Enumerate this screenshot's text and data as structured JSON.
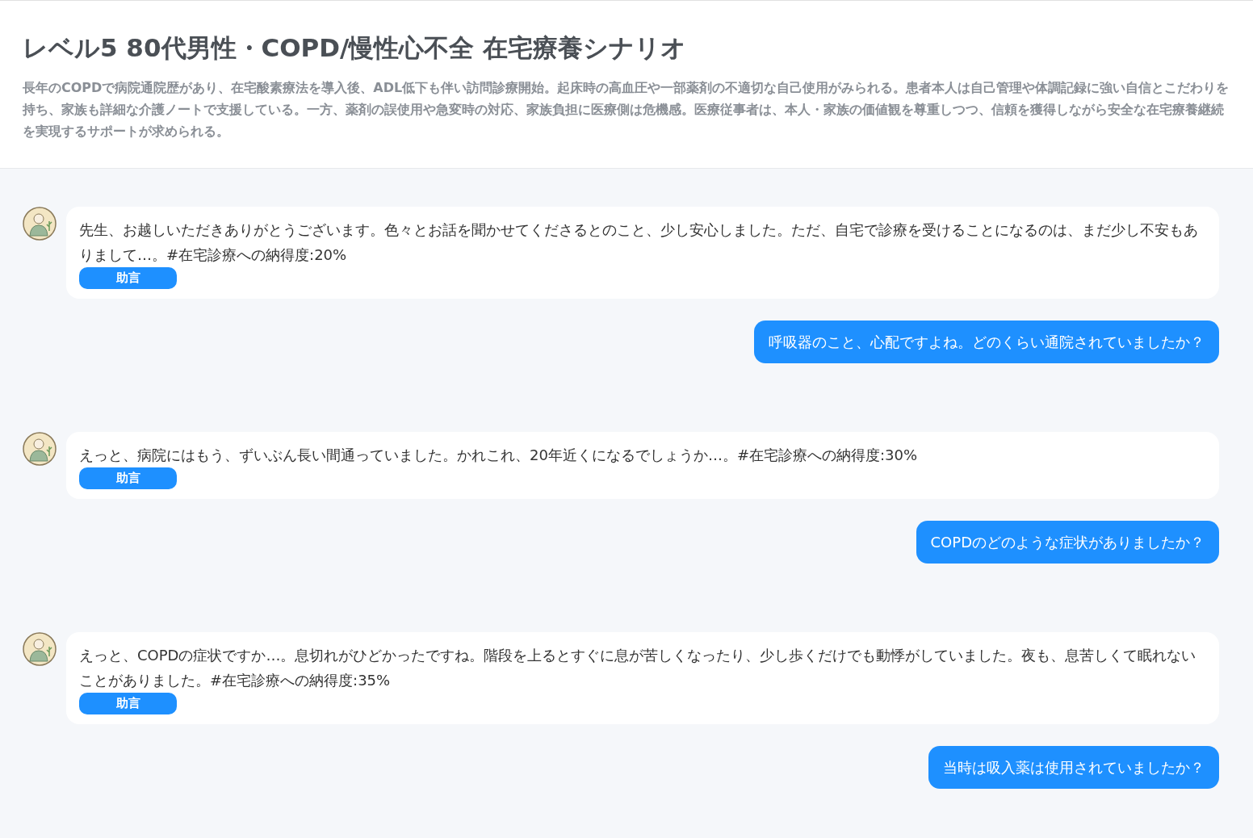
{
  "header": {
    "title": "レベル5 80代男性・COPD/慢性心不全 在宅療養シナリオ",
    "description": "長年のCOPDで病院通院歴があり、在宅酸素療法を導入後、ADL低下も伴い訪問診療開始。起床時の高血圧や一部薬剤の不適切な自己使用がみられる。患者本人は自己管理や体調記録に強い自信とこだわりを持ち、家族も詳細な介護ノートで支援している。一方、薬剤の誤使用や急変時の対応、家族負担に医療側は危機感。医療従事者は、本人・家族の価値観を尊重しつつ、信頼を獲得しながら安全な在宅療養継続を実現するサポートが求められる。"
  },
  "messages": [
    {
      "kind": "patient",
      "text": "先生、お越しいただきありがとうございます。色々とお話を聞かせてくださるとのこと、少し安心しました。ただ、自宅で診療を受けることになるのは、まだ少し不安もありまして…。#在宅診療への納得度:20%",
      "advice": "助言"
    },
    {
      "kind": "user",
      "text": "呼吸器のこと、心配ですよね。どのくらい通院されていましたか？"
    },
    {
      "kind": "patient",
      "text": "えっと、病院にはもう、ずいぶん長い間通っていました。かれこれ、20年近くになるでしょうか…。#在宅診療への納得度:30%",
      "advice": "助言"
    },
    {
      "kind": "user",
      "text": "COPDのどのような症状がありましたか？"
    },
    {
      "kind": "patient",
      "text": "えっと、COPDの症状ですか…。息切れがひどかったですね。階段を上るとすぐに息が苦しくなったり、少し歩くだけでも動悸がしていました。夜も、息苦しくて眠れないことがありました。#在宅診療への納得度:35%",
      "advice": "助言"
    },
    {
      "kind": "user",
      "text": "当時は吸入薬は使用されていましたか？"
    }
  ]
}
